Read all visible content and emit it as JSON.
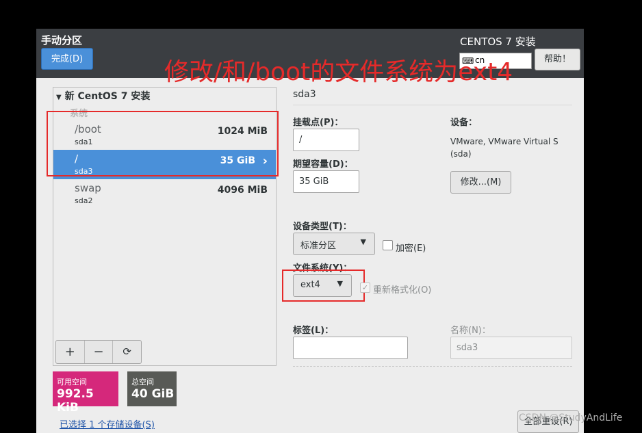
{
  "header": {
    "page_title": "手动分区",
    "done_button": "完成(D)",
    "product_title": "CENTOS 7 安装",
    "keyboard_layout": "cn",
    "help_button": "帮助！"
  },
  "annotation": {
    "overlay_text": "修改/和/boot的文件系统为ext4",
    "highlight_color": "#e52a2a"
  },
  "partitions": {
    "tree_header": "新 CentOS 7 安装",
    "group_label": "系统",
    "rows": [
      {
        "name": "/boot",
        "device": "sda1",
        "size": "1024 MiB"
      },
      {
        "name": "/",
        "device": "sda3",
        "size": "35 GiB",
        "selected": true
      },
      {
        "name": "swap",
        "device": "sda2",
        "size": "4096 MiB"
      }
    ],
    "toolbar": {
      "add": "+",
      "remove": "−",
      "refresh": "⟳"
    }
  },
  "space": {
    "available_label": "可用空间",
    "available_value": "992.5 KiB",
    "total_label": "总空间",
    "total_value": "40 GiB",
    "selected_devices_link": "已选择 1 个存储设备(S)"
  },
  "detail": {
    "title": "sda3",
    "mount_point_label": "挂载点(P)：",
    "mount_point_value": "/",
    "capacity_label": "期望容量(D)：",
    "capacity_value": "35 GiB",
    "device_label": "设备：",
    "device_value_line1": "VMware, VMware Virtual S",
    "device_value_line2": "(sda)",
    "modify_button": "修改...(M)",
    "device_type_label": "设备类型(T)：",
    "device_type_value": "标准分区",
    "encrypt_label": "加密(E)",
    "filesystem_label": "文件系统(Y)：",
    "filesystem_value": "ext4",
    "reformat_label": "重新格式化(O)",
    "tag_label": "标签(L)：",
    "tag_value": "",
    "name_label": "名称(N)：",
    "name_value": "sda3",
    "reset_button": "全部重设(R)"
  },
  "watermark": "CSDN @StudyAndLife",
  "colors": {
    "accent": "#4a90d9",
    "available": "#d5287b",
    "total": "#585a56"
  }
}
